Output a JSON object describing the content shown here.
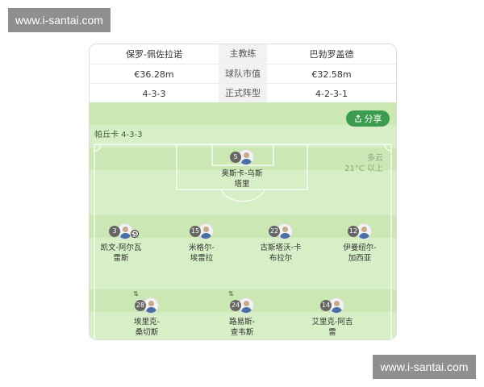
{
  "watermark": {
    "text": "www.i-santai.com"
  },
  "comparison": {
    "rows": [
      {
        "left": "保罗-佩佐拉诺",
        "label": "主教练",
        "right": "巴勃罗盖德"
      },
      {
        "left": "€36.28m",
        "label": "球队市值",
        "right": "€32.58m"
      },
      {
        "left": "4-3-3",
        "label": "正式阵型",
        "right": "4-2-3-1"
      }
    ]
  },
  "pitch": {
    "share_label": "分享",
    "team_label": "帕丘卡 4-3-3",
    "weather": {
      "condition": "多云",
      "temperature": "21°C 以上"
    },
    "colors": {
      "pitch": "#d7efc6",
      "stripe": "#cbe8b4",
      "share": "#3d9b4f",
      "lines": "#ffffff"
    },
    "players": [
      {
        "number": "5",
        "name_line1": "奥斯卡-乌斯",
        "name_line2": "塔里",
        "row": "goalkeeper",
        "has_ball": false,
        "substituted": false
      },
      {
        "number": "3",
        "name_line1": "凯文-阿尔瓦",
        "name_line2": "雷斯",
        "row": "defense",
        "has_ball": true,
        "substituted": false
      },
      {
        "number": "15",
        "name_line1": "米格尔-",
        "name_line2": "埃雷拉",
        "row": "defense",
        "has_ball": false,
        "substituted": false
      },
      {
        "number": "22",
        "name_line1": "古斯塔沃-卡",
        "name_line2": "布拉尔",
        "row": "defense",
        "has_ball": false,
        "substituted": false
      },
      {
        "number": "12",
        "name_line1": "伊曼纽尔-",
        "name_line2": "加西亚",
        "row": "defense",
        "has_ball": false,
        "substituted": false
      },
      {
        "number": "28",
        "name_line1": "埃里克-",
        "name_line2": "桑切斯",
        "row": "midfield",
        "has_ball": false,
        "substituted": true
      },
      {
        "number": "24",
        "name_line1": "路易斯-",
        "name_line2": "查韦斯",
        "row": "midfield",
        "has_ball": false,
        "substituted": true
      },
      {
        "number": "14",
        "name_line1": "艾里克-阿吉",
        "name_line2": "雷",
        "row": "midfield",
        "has_ball": false,
        "substituted": false
      }
    ]
  }
}
